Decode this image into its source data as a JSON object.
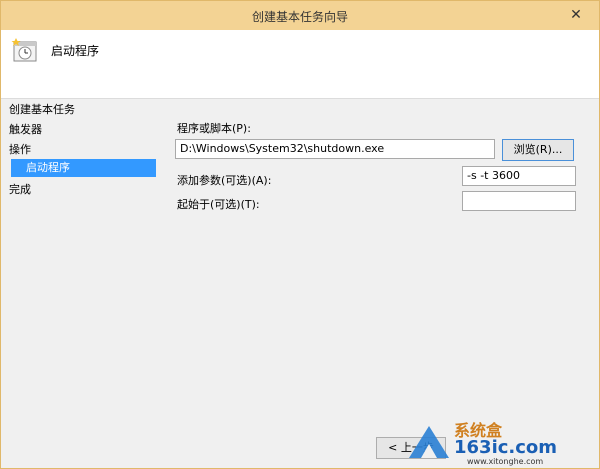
{
  "window": {
    "title": "创建基本任务向导",
    "close_glyph": "✕"
  },
  "header": {
    "title": "启动程序",
    "icon": "task-scheduler-icon"
  },
  "nav": {
    "items": [
      {
        "label": "创建基本任务"
      },
      {
        "label": "触发器"
      },
      {
        "label": "操作"
      },
      {
        "label": "启动程序"
      },
      {
        "label": "完成"
      }
    ]
  },
  "form": {
    "program_label": "程序或脚本(P):",
    "program_value": "D:\\Windows\\System32\\shutdown.exe",
    "browse_label": "浏览(R)...",
    "args_label": "添加参数(可选)(A):",
    "args_value": "-s -t 3600",
    "startin_label": "起始于(可选)(T):",
    "startin_value": ""
  },
  "footer": {
    "back_label": "< 上一步"
  },
  "watermark": {
    "site": "163ic.com",
    "url": "www.xitonghe.com",
    "brand": "系统盒"
  }
}
